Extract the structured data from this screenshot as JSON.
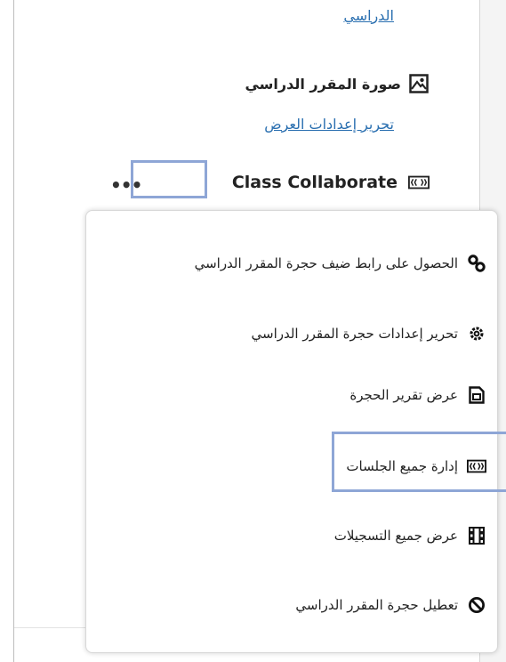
{
  "course": {
    "link_top": "الدراسي",
    "image_label": "صورة المقرر الدراسي",
    "edit_link": "تحرير إعدادات العرض",
    "collaborate_label": "Class Collaborate",
    "more_menu_dots": "•••"
  },
  "menu": {
    "items": [
      {
        "label": "الحصول على رابط ضيف حجرة المقرر الدراسي",
        "icon": "link-icon"
      },
      {
        "label": "تحرير إعدادات حجرة المقرر الدراسي",
        "icon": "gear-icon"
      },
      {
        "label": "عرض تقرير الحجرة",
        "icon": "report-icon"
      },
      {
        "label": "إدارة جميع الجلسات",
        "icon": "sessions-icon"
      },
      {
        "label": "عرض جميع التسجيلات",
        "icon": "film-icon"
      },
      {
        "label": "تعطيل حجرة المقرر الدراسي",
        "icon": "block-icon"
      }
    ]
  }
}
